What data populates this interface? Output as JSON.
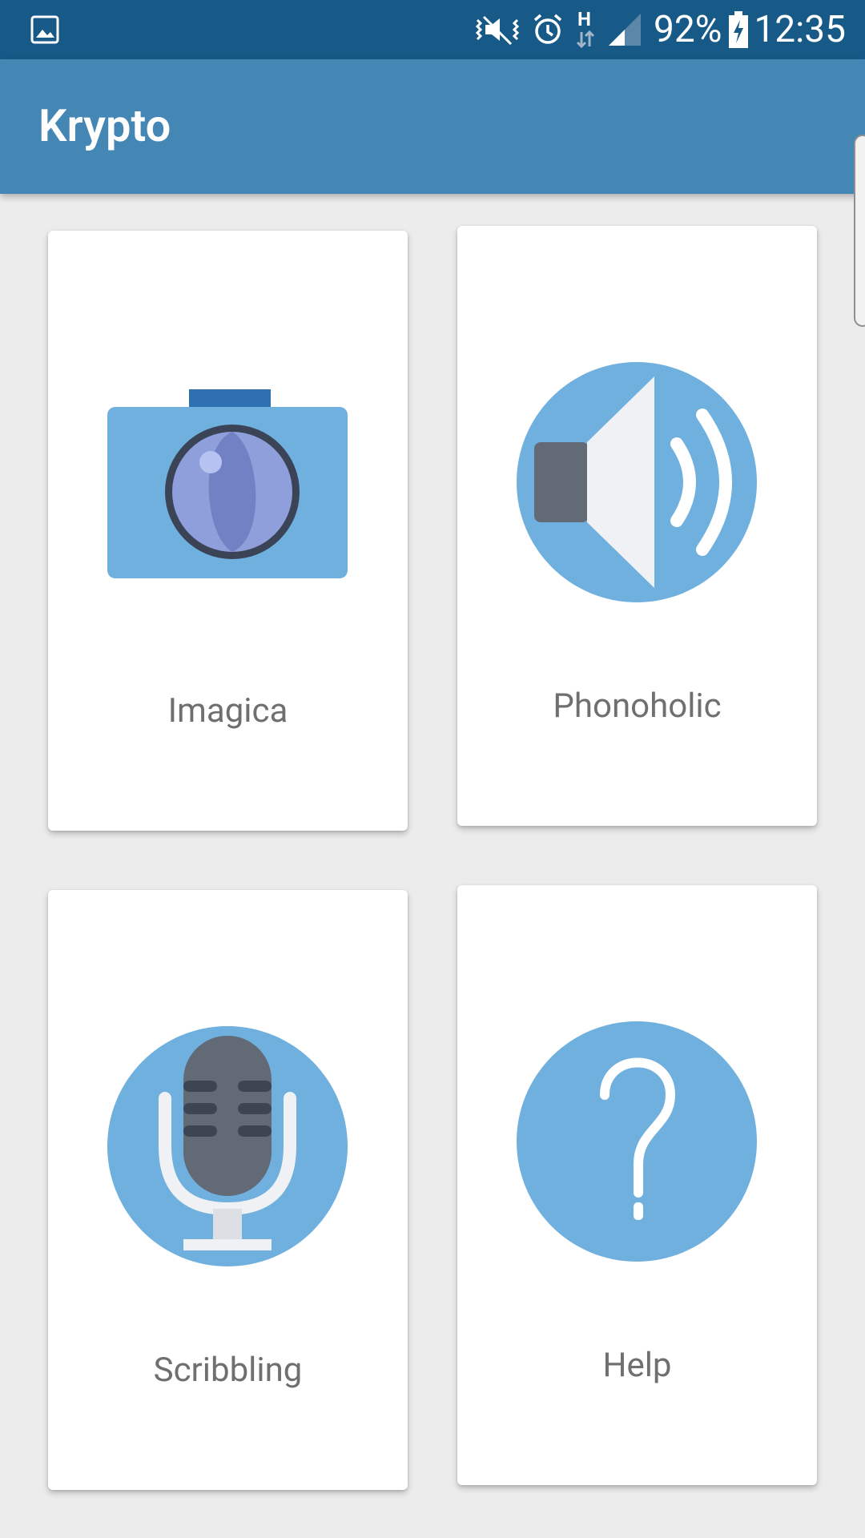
{
  "status_bar": {
    "battery": "92%",
    "time": "12:35",
    "network_label": "H",
    "icons": [
      "gallery-icon",
      "vibrate-mute-icon",
      "alarm-icon",
      "network-h-icon",
      "signal-icon",
      "battery-charging-icon"
    ]
  },
  "app_bar": {
    "title": "Krypto"
  },
  "cards": [
    {
      "label": "Imagica",
      "icon": "camera-icon"
    },
    {
      "label": "Phonoholic",
      "icon": "speaker-icon"
    },
    {
      "label": "Scribbling",
      "icon": "microphone-icon"
    },
    {
      "label": "Help",
      "icon": "question-mark-icon"
    }
  ],
  "colors": {
    "status_bar": "#175a87",
    "app_bar": "#4486b4",
    "icon_blue": "#6fb0df",
    "background": "#ececec"
  }
}
